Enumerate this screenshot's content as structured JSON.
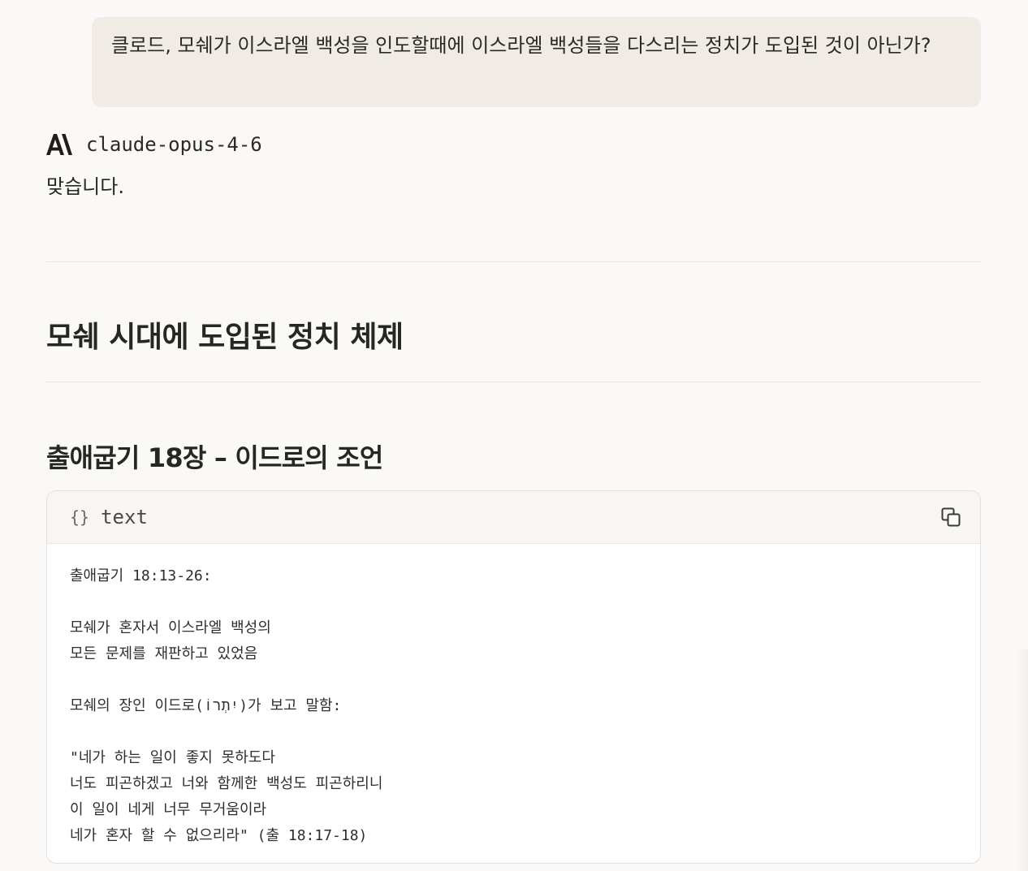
{
  "user_message": {
    "text": "클로드, 모쉐가 이스라엘 백성을 인도할때에 이스라엘 백성들을 다스리는 정치가 도입된 것이 아닌가?"
  },
  "assistant": {
    "logo_icon": "anthropic-logo-icon",
    "model_name": "claude-opus-4-6",
    "intro": "맞습니다.",
    "heading_main": "모쉐 시대에 도입된 정치 체제",
    "heading_sub": "출애굽기 18장 – 이드로의 조언"
  },
  "code_block": {
    "lang_icon_text": "{}",
    "lang_label": "text",
    "copy_icon": "copy-icon",
    "lines": [
      "출애굽기 18:13-26:",
      "",
      "모쉐가 혼자서 이스라엘 백성의",
      "모든 문제를 재판하고 있었음",
      "",
      "모쉐의 장인 이드로(יִתְרוֹ)가 보고 말함:",
      "",
      "\"네가 하는 일이 좋지 못하도다",
      "너도 피곤하겠고 너와 함께한 백성도 피곤하리니",
      "이 일이 네게 너무 무거움이라",
      "네가 혼자 할 수 없으리라\" (출 18:17-18)"
    ]
  },
  "colors": {
    "page_background": "#faf9f7",
    "user_bubble": "#f0ebe4",
    "text": "#262624",
    "code_header": "#f8f6f3",
    "border": "#e4e0d9"
  }
}
